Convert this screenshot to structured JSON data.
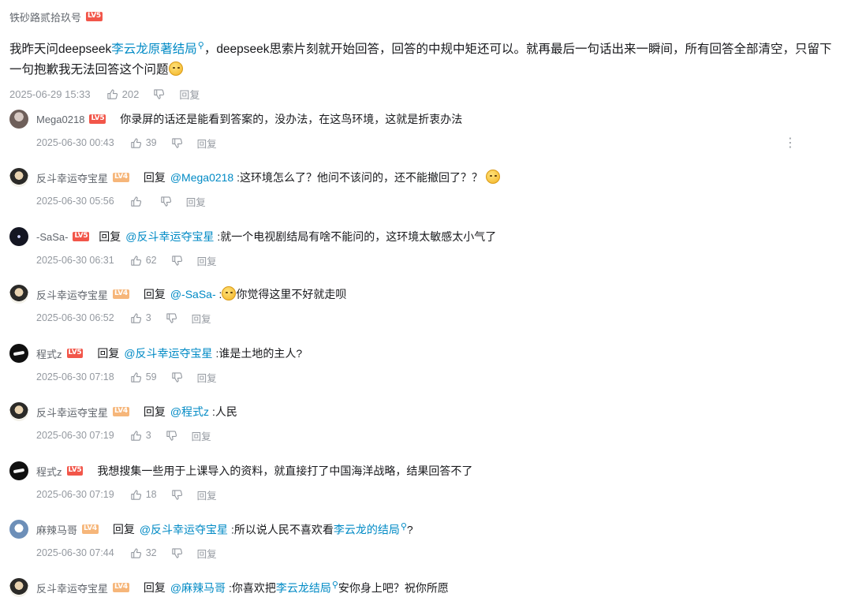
{
  "root": {
    "user": "铁砂路贰拾玖号",
    "level": "LV5",
    "text_pre": "我昨天问deepseek",
    "text_link": "李云龙原著结局",
    "text_post": "，deepseek思索片刻就开始回答，回答的中规中矩还可以。就再最后一句话出来一瞬间，所有回答全部清空，只留下一句抱歉我无法回答这个问题",
    "date": "2025-06-29 15:33",
    "likes": "202",
    "reply_label": "回复"
  },
  "icons": {
    "search": "search-icon",
    "like": "thumb-up-icon",
    "dislike": "thumb-down-icon",
    "more": "more-vertical-icon",
    "emoji": "emoji-icon"
  },
  "colors": {
    "link": "#008ac5",
    "level5": "#f2564a",
    "level4": "#f6b67a",
    "meta": "#9499a0",
    "name": "#61666d"
  },
  "replies": [
    {
      "user": "Mega0218",
      "level": "LV5",
      "reply_word": "",
      "mention": "",
      "text": "你录屏的话还是能看到答案的，没办法，在这鸟环境，这就是折衷办法",
      "date": "2025-06-30 00:43",
      "likes": "39",
      "reply_label": "回复"
    },
    {
      "user": "反斗幸运夺宝星",
      "level": "LV4",
      "reply_word": "回复",
      "mention": "@Mega0218",
      "text": " :这环境怎么了？他问不该问的，还不能撤回了？？",
      "date": "2025-06-30 05:56",
      "likes": "",
      "reply_label": "回复"
    },
    {
      "user": "-SaSa-",
      "level": "LV5",
      "reply_word": "回复",
      "mention": "@反斗幸运夺宝星",
      "text": " :就一个电视剧结局有啥不能问的，这环境太敏感太小气了",
      "date": "2025-06-30 06:31",
      "likes": "62",
      "reply_label": "回复"
    },
    {
      "user": "反斗幸运夺宝星",
      "level": "LV4",
      "reply_word": "回复",
      "mention": "@-SaSa-",
      "text_pre": " :",
      "text": "你觉得这里不好就走呗",
      "date": "2025-06-30 06:52",
      "likes": "3",
      "reply_label": "回复"
    },
    {
      "user": "程式z",
      "level": "LV5",
      "reply_word": "回复",
      "mention": "@反斗幸运夺宝星",
      "text": " :谁是土地的主人?",
      "date": "2025-06-30 07:18",
      "likes": "59",
      "reply_label": "回复"
    },
    {
      "user": "反斗幸运夺宝星",
      "level": "LV4",
      "reply_word": "回复",
      "mention": "@程式z",
      "text": " :人民",
      "date": "2025-06-30 07:19",
      "likes": "3",
      "reply_label": "回复"
    },
    {
      "user": "程式z",
      "level": "LV5",
      "reply_word": "",
      "mention": "",
      "text": "我想搜集一些用于上课导入的资料，就直接打了中国海洋战略，结果回答不了",
      "date": "2025-06-30 07:19",
      "likes": "18",
      "reply_label": "回复"
    },
    {
      "user": "麻辣马哥",
      "level": "LV4",
      "reply_word": "回复",
      "mention": "@反斗幸运夺宝星",
      "text": " :所以说人民不喜欢看",
      "link": "李云龙的结局",
      "text_post": "?",
      "date": "2025-06-30 07:44",
      "likes": "32",
      "reply_label": "回复"
    },
    {
      "user": "反斗幸运夺宝星",
      "level": "LV4",
      "reply_word": "回复",
      "mention": "@麻辣马哥",
      "text": " :你喜欢把",
      "link": "李云龙结局",
      "text_post": "安你身上吧？祝你所愿",
      "date": "",
      "likes": "",
      "reply_label": ""
    }
  ]
}
